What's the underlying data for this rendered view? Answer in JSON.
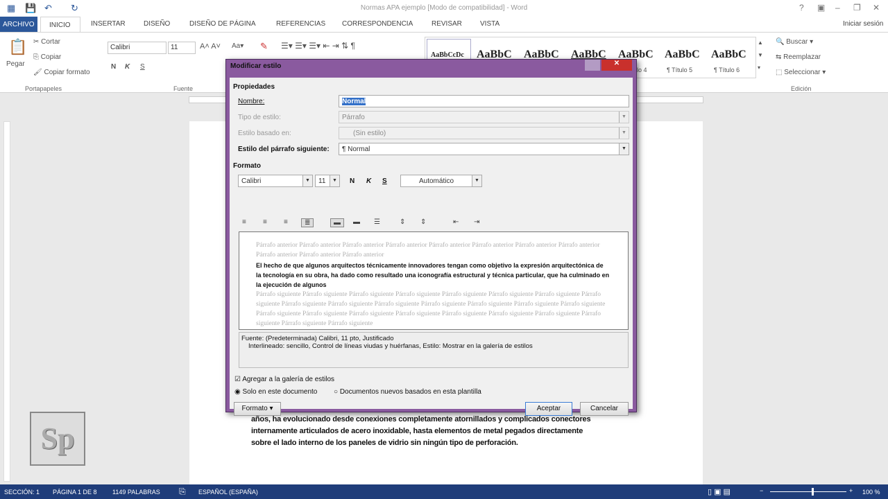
{
  "window": {
    "title": "Normas APA ejemplo [Modo de compatibilidad] - Word",
    "controls": [
      "?",
      "▣",
      "–",
      "❐",
      "✕"
    ],
    "signin": "Iniciar sesión"
  },
  "tabs": [
    "ARCHIVO",
    "INICIO",
    "INSERTAR",
    "DISEÑO",
    "DISEÑO DE PÁGINA",
    "REFERENCIAS",
    "CORRESPONDENCIA",
    "REVISAR",
    "VISTA"
  ],
  "ribbon": {
    "clipboard": {
      "paste": "Pegar",
      "cut": "Cortar",
      "copy": "Copiar",
      "format_painter": "Copiar formato",
      "label": "Portapapeles"
    },
    "font": {
      "name": "Calibri",
      "size": "11",
      "label": "Fuente",
      "bold": "N",
      "italic": "K",
      "underline": "S"
    },
    "styles": [
      {
        "preview": "AaBbCcDc",
        "label": ""
      },
      {
        "preview": "AaBbC",
        "label": ""
      },
      {
        "preview": "AaBbC",
        "label": ""
      },
      {
        "preview": "AaBbC",
        "label": ""
      },
      {
        "preview": "AaBbC",
        "label": "lo 4"
      },
      {
        "preview": "AaBbC",
        "label": "¶ Título 5"
      },
      {
        "preview": "AaBbC",
        "label": "¶ Título 6"
      }
    ],
    "editing": {
      "find": "Buscar",
      "replace": "Reemplazar",
      "select": "Seleccionar",
      "label": "Edición"
    }
  },
  "dialog": {
    "title": "Modificar estilo",
    "properties_label": "Propiedades",
    "name_label": "Nombre:",
    "name_value": "Normal",
    "type_label": "Tipo de estilo:",
    "type_value": "Párrafo",
    "based_label": "Estilo basado en:",
    "based_value": "(Sin estilo)",
    "next_label": "Estilo del párrafo siguiente:",
    "next_value": "¶  Normal",
    "format_label": "Formato",
    "font": "Calibri",
    "size": "11",
    "bold": "N",
    "italic": "K",
    "underline": "S",
    "color": "Automático",
    "preview_prev": "Párrafo anterior Párrafo anterior Párrafo anterior Párrafo anterior Párrafo anterior Párrafo anterior Párrafo anterior Párrafo anterior Párrafo anterior Párrafo anterior Párrafo anterior",
    "preview_main": "El hecho de que algunos arquitectos técnicamente innovadores tengan como objetivo la expresión arquitectónica de la tecnología en su obra, ha dado como resultado una iconografía estructural y técnica particular, que ha culminado en la ejecución de algunos",
    "preview_next": "Párrafo siguiente Párrafo siguiente Párrafo siguiente Párrafo siguiente Párrafo siguiente Párrafo siguiente Párrafo siguiente Párrafo siguiente Párrafo siguiente Párrafo siguiente Párrafo siguiente Párrafo siguiente Párrafo siguiente Párrafo siguiente Párrafo siguiente Párrafo siguiente Párrafo siguiente Párrafo siguiente Párrafo siguiente Párrafo siguiente Párrafo siguiente Párrafo siguiente Párrafo siguiente Párrafo siguiente Párrafo siguiente",
    "desc_line1": "Fuente: (Predeterminada) Calibri, 11 pto, Justificado",
    "desc_line2": "Interlineado:  sencillo, Control de líneas viudas y huérfanas, Estilo: Mostrar en la galería de estilos",
    "add_gallery": "Agregar a la galería de estilos",
    "add_gallery_checked": true,
    "only_doc": "Solo en este documento",
    "new_docs": "Documentos nuevos basados en esta plantilla",
    "selected_scope": "Solo en este documento",
    "format_btn": "Formato ▾",
    "ok": "Aceptar",
    "cancel": "Cancelar"
  },
  "document": {
    "lines": [
      "años, ha evolucionado desde conexiones completamente atornillados y complicados conectores",
      "internamente articulados de acero inoxidable, hasta elementos de metal pegados directamente",
      "sobre el lado interno de los paneles de vidrio sin ningún tipo de perforación."
    ]
  },
  "logo": "Sp",
  "status": {
    "section": "SECCIÓN: 1",
    "page": "PÁGINA 1 DE 8",
    "words": "1149 PALABRAS",
    "language": "ESPAÑOL (ESPAÑA)",
    "zoom": "100 %",
    "zoom_percent": 100
  },
  "colors": {
    "accent": "#2b579a",
    "status_bar": "#1f3d7a",
    "dialog_frame": "#8a5a9f",
    "close": "#c9302c"
  }
}
